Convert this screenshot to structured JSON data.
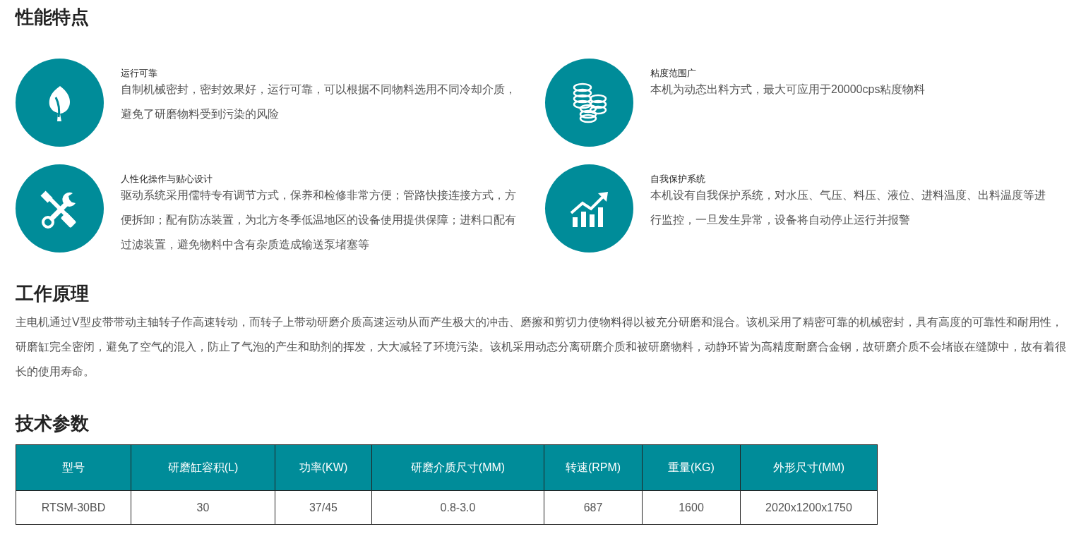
{
  "sections": [
    {
      "heading": "性能特点"
    },
    {
      "heading": "工作原理"
    },
    {
      "heading": "技术参数"
    }
  ],
  "features": [
    {
      "title": "运行可靠",
      "text": "自制机械密封，密封效果好，运行可靠，可以根据不同物料选用不同冷却介质，避免了研磨物料受到污染的风险"
    },
    {
      "title": "粘度范围广",
      "text": "本机为动态出料方式，最大可应用于20000cps粘度物料"
    },
    {
      "title": "人性化操作与贴心设计",
      "text": "驱动系统采用儒特专有调节方式，保养和检修非常方便；管路快接连接方式，方便拆卸；配有防冻装置，为北方冬季低温地区的设备使用提供保障；进料口配有过滤装置，避免物料中含有杂质造成输送泵堵塞等"
    },
    {
      "title": "自我保护系统",
      "text": "本机设有自我保护系统，对水压、气压、料压、液位、进料温度、出料温度等进行监控，一旦发生异常，设备将自动停止运行并报警"
    }
  ],
  "principle": "主电机通过V型皮带带动主轴转子作高速转动，而转子上带动研磨介质高速运动从而产生极大的冲击、磨擦和剪切力使物料得以被充分研磨和混合。该机采用了精密可靠的机械密封，具有高度的可靠性和耐用性，研磨缸完全密闭，避免了空气的混入，防止了气泡的产生和助剂的挥发，大大减轻了环境污染。该机采用动态分离研磨介质和被研磨物料，动静环皆为高精度耐磨合金钢，故研磨介质不会堵嵌在缝隙中，故有着很长的使用寿命。",
  "table": {
    "columns": [
      "型号",
      "研磨缸容积(L)",
      "功率(KW)",
      "研磨介质尺寸(MM)",
      "转速(RPM)",
      "重量(KG)",
      "外形尺寸(MM)"
    ],
    "rows": [
      [
        "RTSM-30BD",
        "30",
        "37/45",
        "0.8-3.0",
        "687",
        "1600",
        "2020x1200x1750"
      ]
    ]
  }
}
